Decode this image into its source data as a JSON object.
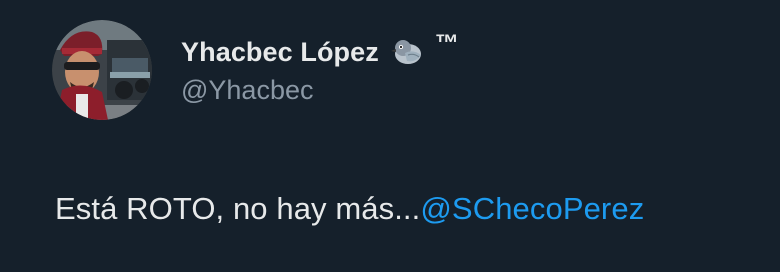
{
  "author": {
    "display_name": "Yhacbec López",
    "badge_emoji": "pigeon-emoji",
    "trademark": "™",
    "handle": "@Yhacbec",
    "avatar": "profile-photo"
  },
  "tweet": {
    "text": "Está ROTO, no hay más...",
    "mention": "@SChecoPerez"
  },
  "colors": {
    "background": "#15202b",
    "primary_text": "#e7e9ea",
    "secondary_text": "#8b98a5",
    "link": "#1d9bf0"
  }
}
